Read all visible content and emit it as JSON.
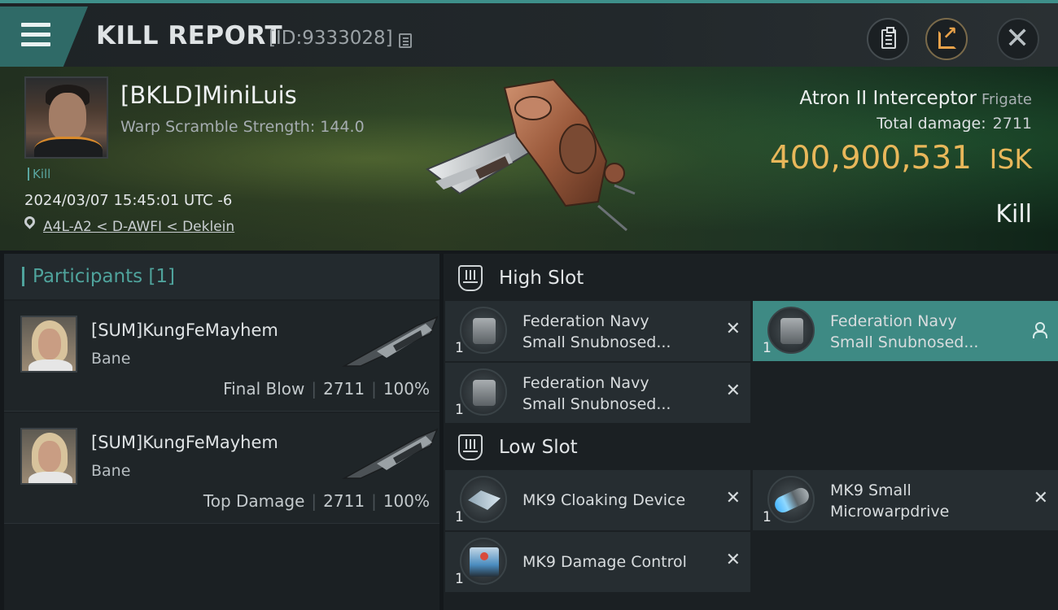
{
  "header": {
    "title": "KILL REPORT",
    "report_id": "[ID:9333028]"
  },
  "victim": {
    "name": "[BKLD]MiniLuis",
    "warp_scramble": "Warp Scramble Strength: 144.0",
    "kill_tag": "Kill",
    "timestamp": "2024/03/07 15:45:01 UTC -6",
    "location": "A4L-A2 < D-AWFI < Deklein"
  },
  "ship": {
    "name": "Atron II Interceptor",
    "class": "Frigate",
    "total_damage_label": "Total damage:",
    "total_damage_value": "2711",
    "isk_value": "400,900,531",
    "isk_unit": "ISK",
    "result": "Kill"
  },
  "participants": {
    "header": "Participants [1]",
    "rows": [
      {
        "name": "[SUM]KungFeMayhem",
        "ship": "Bane",
        "role": "Final Blow",
        "damage": "2711",
        "percent": "100%"
      },
      {
        "name": "[SUM]KungFeMayhem",
        "ship": "Bane",
        "role": "Top Damage",
        "damage": "2711",
        "percent": "100%"
      }
    ]
  },
  "slots": {
    "high": {
      "label": "High Slot",
      "modules": [
        {
          "line1": "Federation Navy",
          "line2": "Small Snubnosed...",
          "qty": "1",
          "icon": "turret-icon"
        },
        {
          "line1": "Federation Navy",
          "line2": "Small Snubnosed...",
          "qty": "1",
          "icon": "turret-icon"
        },
        {
          "line1": "Federation Navy",
          "line2": "Small Snubnosed...",
          "qty": "1",
          "icon": "turret-icon"
        }
      ]
    },
    "low": {
      "label": "Low Slot",
      "modules": [
        {
          "line1": "MK9 Cloaking Device",
          "qty": "1",
          "icon": "cloak-icon"
        },
        {
          "line1": "MK9 Small",
          "line2": "Microwarpdrive",
          "qty": "1",
          "icon": "microwarpdrive-icon"
        },
        {
          "line1": "MK9 Damage Control",
          "qty": "1",
          "icon": "damage-control-icon"
        }
      ]
    }
  },
  "colors": {
    "accent": "#3e8a84",
    "isk": "#e8b75a",
    "teal_text": "#4fa39c"
  }
}
